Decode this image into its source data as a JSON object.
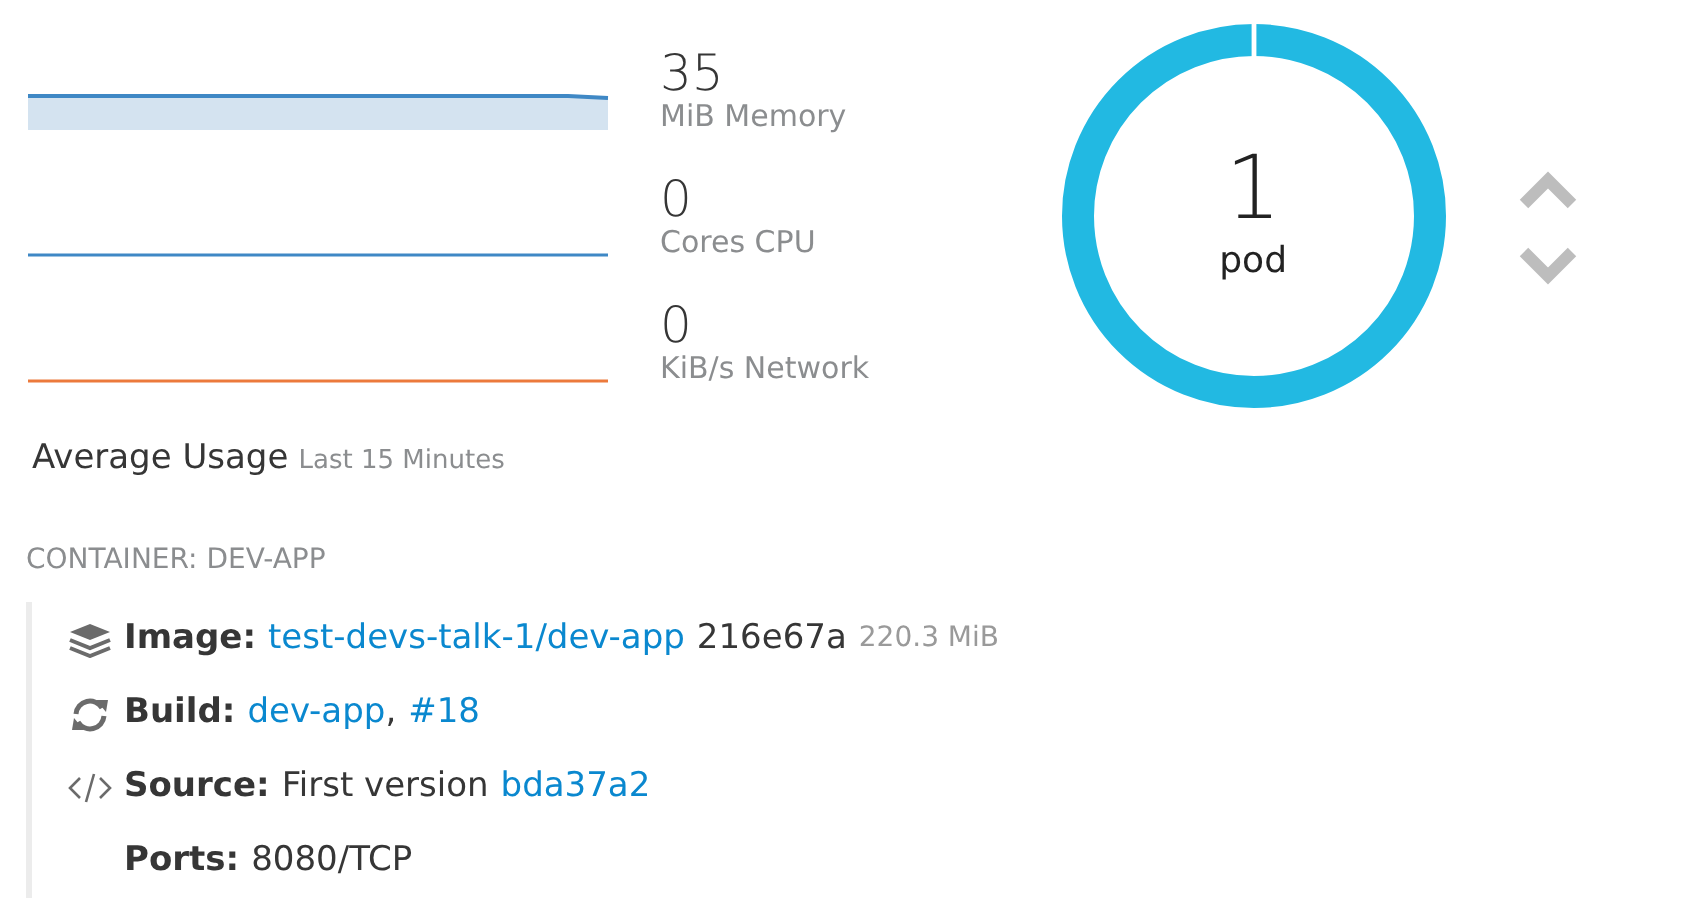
{
  "metrics": [
    {
      "value": "35",
      "unit": "MiB Memory",
      "color": "#3f88c5",
      "kind": "area"
    },
    {
      "value": "0",
      "unit": "Cores CPU",
      "color": "#3f88c5",
      "kind": "line"
    },
    {
      "value": "0",
      "unit": "KiB/s Network",
      "color": "#ec7a3c",
      "kind": "line"
    }
  ],
  "usage": {
    "title": "Average Usage",
    "subtitle": "Last 15 Minutes"
  },
  "pods": {
    "count": "1",
    "label": "pod"
  },
  "container": {
    "heading": "CONTAINER: DEV-APP",
    "rows": [
      {
        "kind": "layers",
        "label": "Image:",
        "parts": [
          {
            "kind": "link",
            "text": "test-devs-talk-1/dev-app"
          },
          {
            "kind": "text",
            "text": "216e67a"
          },
          {
            "kind": "muted",
            "text": "220.3 MiB"
          }
        ]
      },
      {
        "kind": "refresh",
        "label": "Build:",
        "parts": [
          {
            "kind": "link",
            "text": "dev-app"
          },
          {
            "kind": "text",
            "text": ","
          },
          {
            "kind": "link",
            "text": "#18"
          }
        ]
      },
      {
        "kind": "code",
        "label": "Source:",
        "parts": [
          {
            "kind": "text",
            "text": "First version"
          },
          {
            "kind": "link",
            "text": "bda37a2"
          }
        ]
      },
      {
        "kind": "plain",
        "label": "Ports:",
        "parts": [
          {
            "kind": "text",
            "text": "8080/TCP"
          }
        ]
      }
    ]
  }
}
